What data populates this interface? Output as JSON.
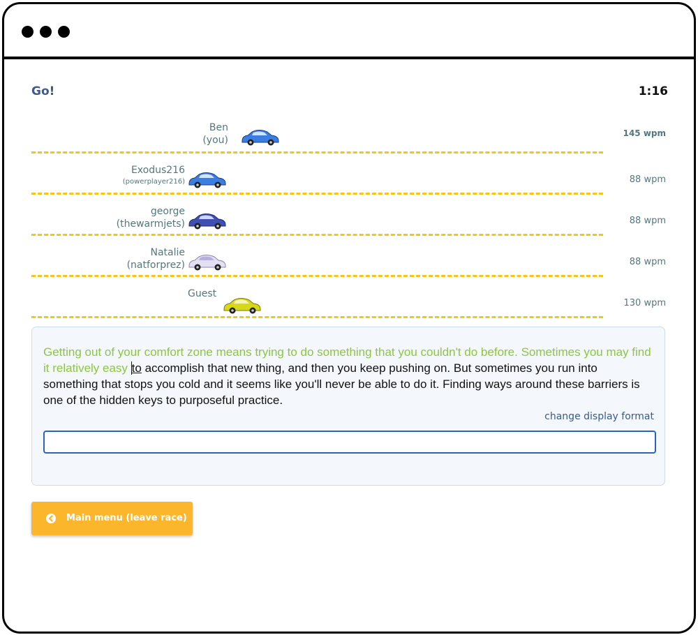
{
  "race": {
    "status": "Go!",
    "timer": "1:16"
  },
  "lanes": [
    {
      "name": "Ben",
      "sub": "(you)",
      "wpm": "145 wpm",
      "car_color": "#3b7de0",
      "progress": 0.35
    },
    {
      "name": "Exodus216",
      "sub": "(powerplayer216)",
      "wpm": "88 wpm",
      "car_color": "#3b7de0",
      "progress": 0.26
    },
    {
      "name": "george",
      "sub": "(thewarmjets)",
      "wpm": "88 wpm",
      "car_color": "#3f4fb4",
      "progress": 0.26
    },
    {
      "name": "Natalie",
      "sub": "(natforprez)",
      "wpm": "88 wpm",
      "car_color": "#c9c3e6",
      "progress": 0.26
    },
    {
      "name": "Guest",
      "sub": "",
      "wpm": "130 wpm",
      "car_color": "#d6d81a",
      "progress": 0.33
    }
  ],
  "typing": {
    "typed": "Getting out of your comfort zone means trying to do something that you couldn't do before. Sometimes you may find it relatively easy ",
    "current": "to",
    "remaining": " accomplish that new thing, and then you keep pushing on. But sometimes you run into something that stops you cold and it seems like you'll never be able to do it. Finding ways around these barriers is one of the hidden keys to purposeful practice.",
    "change_format": "change display format",
    "input_value": ""
  },
  "buttons": {
    "main_menu": "Main menu (leave race)"
  },
  "colors": {
    "typed_text": "#8cc63f",
    "lane_divider": "#f5c518",
    "button": "#fbb62b",
    "input_border": "#2b63b8"
  }
}
